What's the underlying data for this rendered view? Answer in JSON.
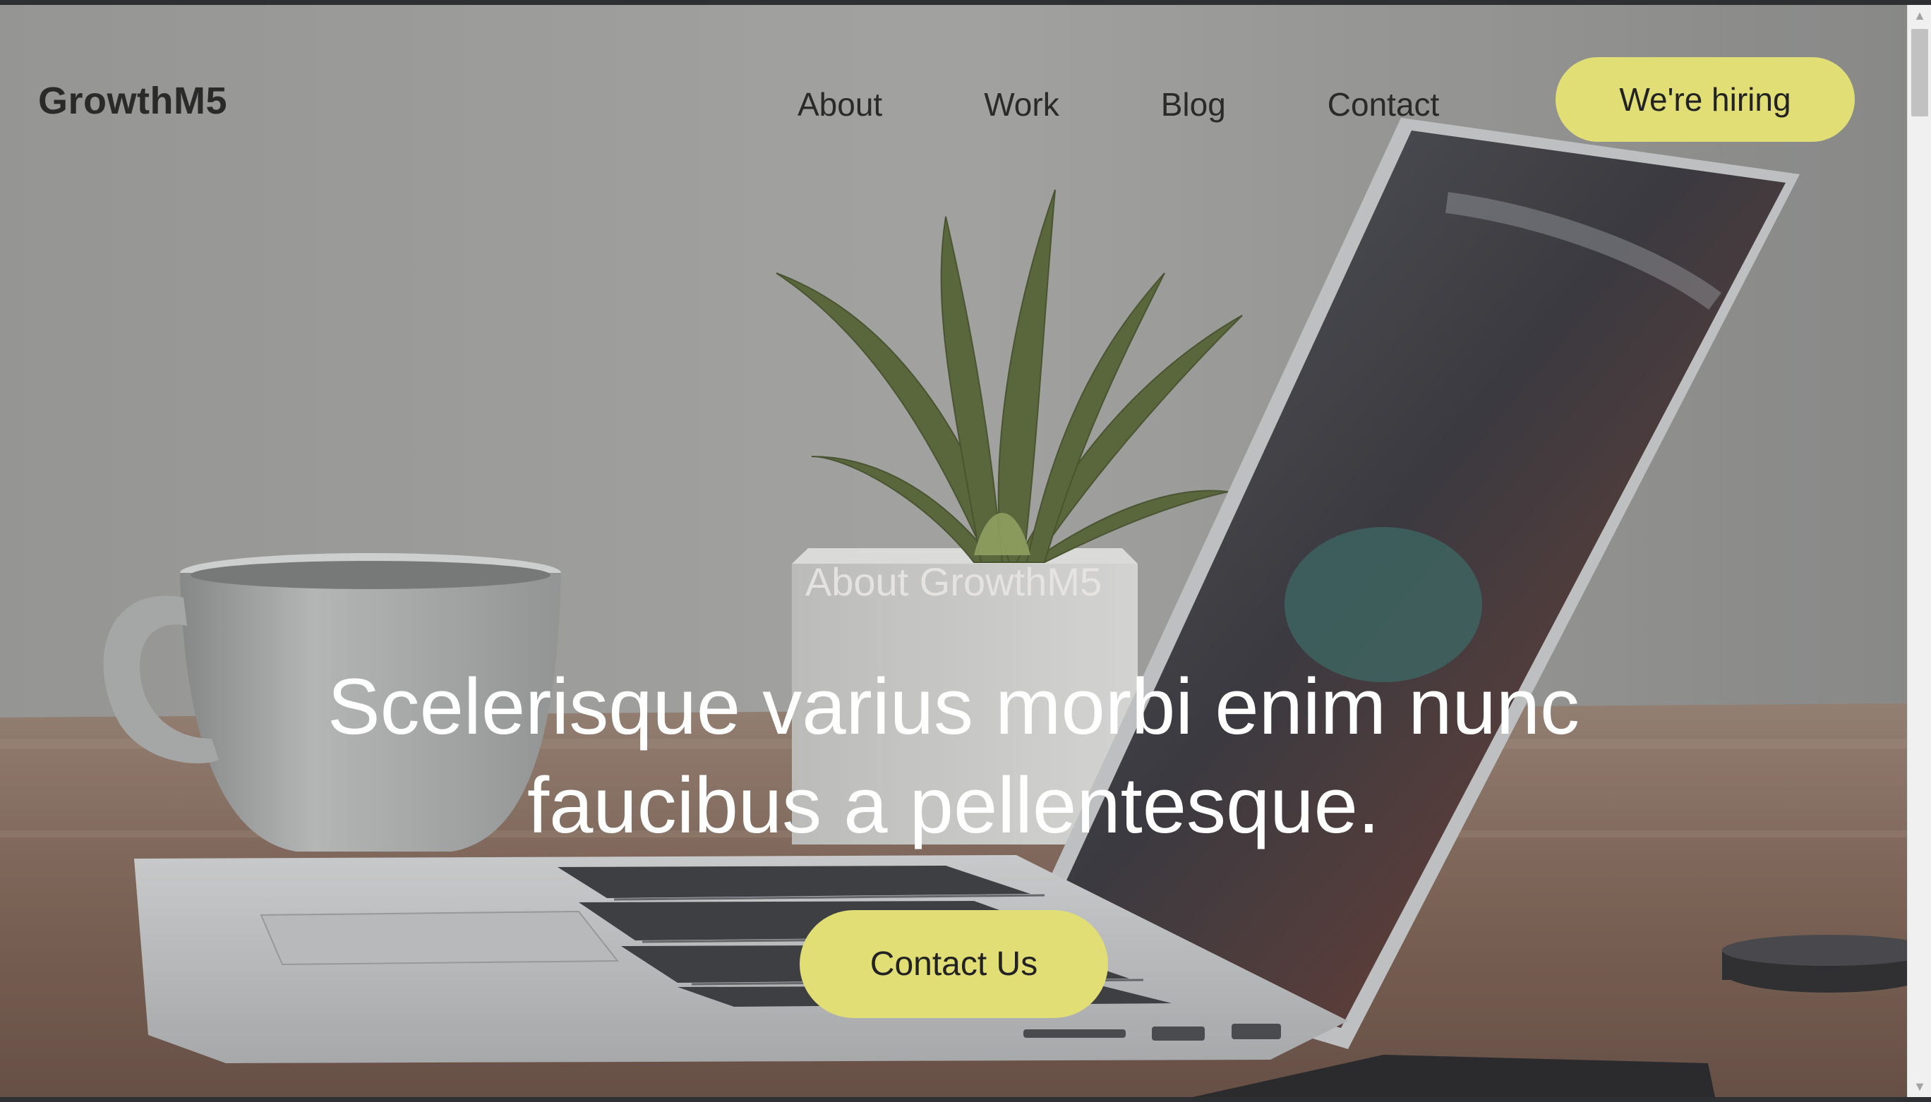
{
  "nav": {
    "logo": "GrowthM5",
    "links": [
      {
        "label": "About"
      },
      {
        "label": "Work"
      },
      {
        "label": "Blog"
      },
      {
        "label": "Contact"
      }
    ],
    "cta_label": "We're hiring"
  },
  "hero": {
    "eyebrow": "About GrowthM5",
    "headline": "Scelerisque varius morbi enim nunc faucibus a pellentesque.",
    "cta_label": "Contact Us",
    "background_image": "desk scene with laptop, coffee cup and potted plant"
  },
  "colors": {
    "accent": "#e1de75",
    "nav_text": "#2a2a2a",
    "hero_text": "#ffffff"
  },
  "icons": {
    "scroll_up": "triangle-up-icon",
    "scroll_down": "triangle-down-icon"
  }
}
